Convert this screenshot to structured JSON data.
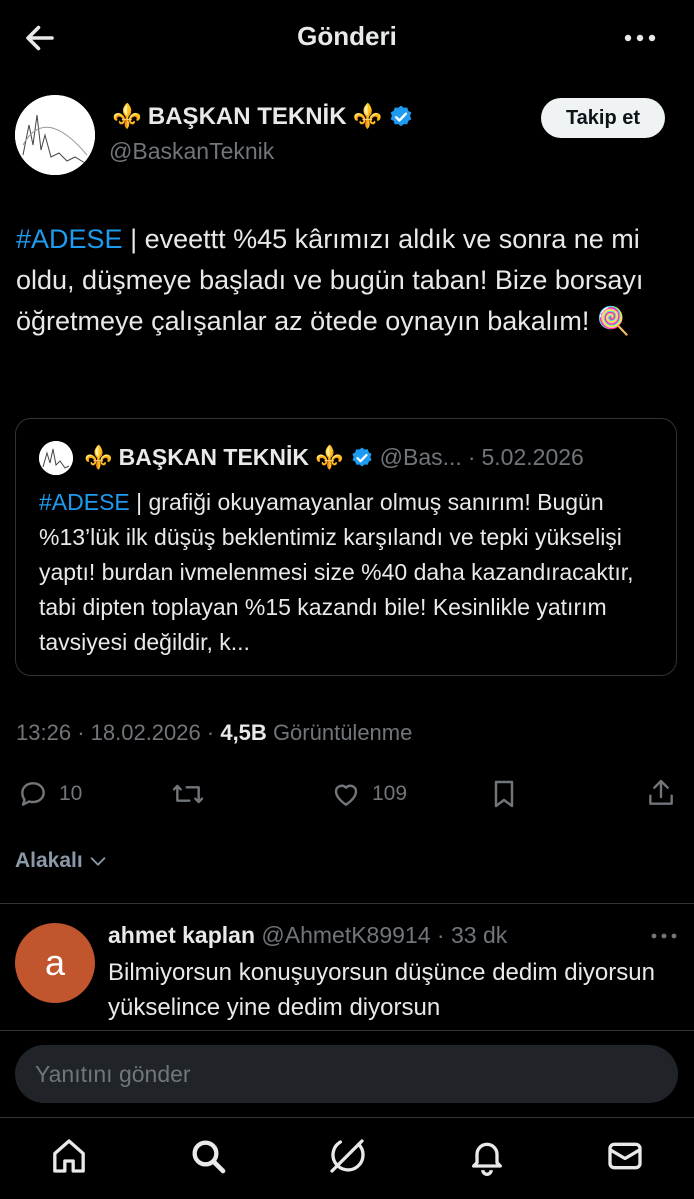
{
  "header": {
    "title": "Gönderi"
  },
  "author": {
    "name_prefix": "⚜️",
    "name": "BAŞKAN TEKNİK",
    "name_suffix": "⚜️",
    "handle": "@BaskanTeknik",
    "follow_label": "Takip et"
  },
  "tweet": {
    "hashtag": "#ADESE",
    "text": " | eveettt %45 kârımızı aldık ve sonra ne mi oldu, düşmeye başladı ve bugün taban! Bize borsayı öğretmeye çalışanlar az ötede oynayın bakalım! 🍭"
  },
  "quote": {
    "name_prefix": "⚜️",
    "name": "BAŞKAN TEKNİK",
    "name_suffix": "⚜️",
    "handle": "@Bas...",
    "date": "5.02.2026",
    "hashtag": "#ADESE",
    "text": " | grafiği okuyamayanlar olmuş sanırım! Bugün %13’lük ilk düşüş beklentimiz karşılandı ve tepki yükselişi yaptı! burdan ivmelenmesi size %40 daha kazandıracaktır, tabi dipten toplayan %15 kazandı bile! Kesinlikle yatırım tavsiyesi değildir, k..."
  },
  "meta": {
    "time": "13:26",
    "date": "18.02.2026",
    "views": "4,5B",
    "views_label": "Görüntülenme"
  },
  "actions": {
    "replies": "10",
    "likes": "109"
  },
  "related_label": "Alakalı",
  "reply": {
    "avatar_letter": "a",
    "name": "ahmet kaplan",
    "handle": "@AhmetK89914",
    "time": "33 dk",
    "text": "Bilmiyorsun konuşuyorsun düşünce dedim diyorsun yükselince yine dedim diyorsun"
  },
  "composer": {
    "placeholder": "Yanıtını gönder"
  },
  "colors": {
    "accent": "#1d9bf0",
    "background": "#000000",
    "muted": "#71767b"
  }
}
